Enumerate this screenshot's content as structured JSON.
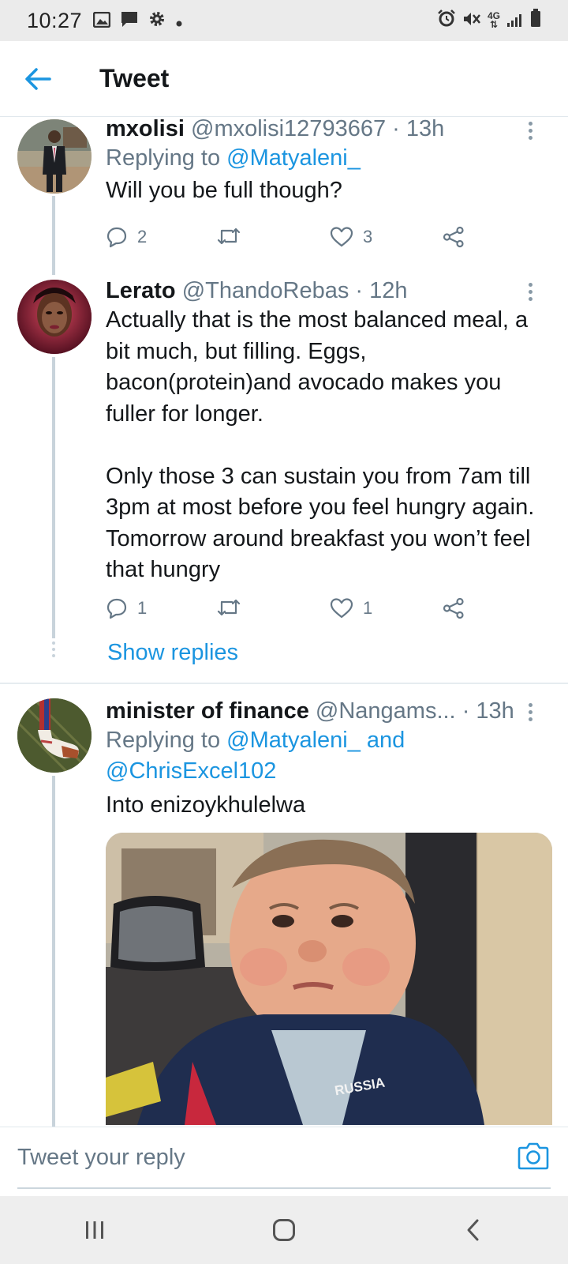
{
  "status_bar": {
    "time": "10:27",
    "network": "4G",
    "left_icons": [
      "image-icon",
      "message-icon",
      "gear-icon",
      "dot-icon"
    ],
    "right_icons": [
      "alarm-icon",
      "mute-icon",
      "network-4g-icon",
      "signal-icon",
      "battery-icon"
    ]
  },
  "header": {
    "title": "Tweet"
  },
  "tweets": [
    {
      "name": "mxolisi",
      "handle": "@mxolisi12793667",
      "time": "· 13h",
      "replying_prefix": "Replying to ",
      "replying_to": "@Matyaleni_",
      "replying_more": "",
      "text": "Will you be full though?",
      "replies": "2",
      "retweets": "",
      "likes": "3"
    },
    {
      "name": "Lerato",
      "handle": "@ThandoRebas",
      "time": "· 12h",
      "text": "Actually that is the most balanced meal, a bit much, but filling. Eggs, bacon(protein)and avocado makes you fuller for longer.\n\nOnly those 3 can sustain you from 7am till 3pm at most before you feel hungry again. Tomorrow around breakfast you won’t feel that hungry",
      "replies": "1",
      "retweets": "",
      "likes": "1",
      "show_replies": "Show replies"
    },
    {
      "name": "minister of finance",
      "handle": "@Nangams...",
      "time": "· 13h",
      "replying_prefix": "Replying to ",
      "replying_to": "@Matyaleni_ and",
      "replying_more": "@ChrisExcel102",
      "text": "Into enizoykhulelwa",
      "media_caption": "RUSSIA"
    }
  ],
  "reply_bar": {
    "placeholder": "Tweet your reply"
  },
  "colors": {
    "accent": "#1b95e0",
    "muted": "#657786",
    "text": "#14171a",
    "thread_line": "#c8d3db"
  }
}
